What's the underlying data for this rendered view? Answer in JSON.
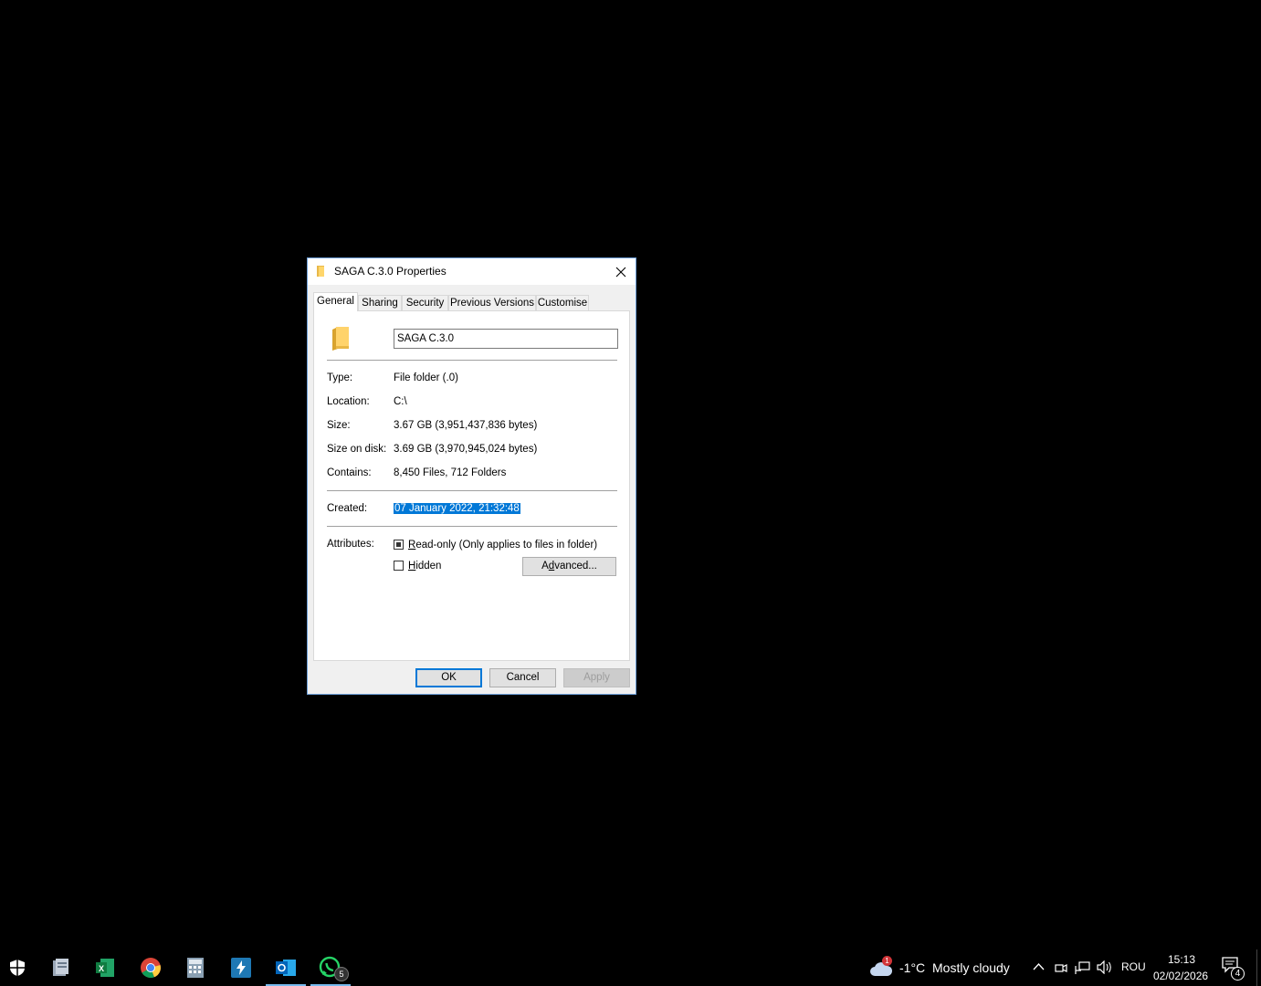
{
  "dialog": {
    "title": "SAGA C.3.0 Properties",
    "tabs": [
      {
        "label": "General",
        "active": true
      },
      {
        "label": "Sharing"
      },
      {
        "label": "Security"
      },
      {
        "label": "Previous Versions"
      },
      {
        "label": "Customise"
      }
    ],
    "folder_name": "SAGA C.3.0",
    "type_label": "Type:",
    "type_value": "File folder (.0)",
    "location_label": "Location:",
    "location_value": "C:\\",
    "size_label": "Size:",
    "size_value": "3.67 GB (3,951,437,836 bytes)",
    "size_on_disk_label": "Size on disk:",
    "size_on_disk_value": "3.69 GB (3,970,945,024 bytes)",
    "contains_label": "Contains:",
    "contains_value": "8,450 Files, 712 Folders",
    "created_label": "Created:",
    "created_value": "07 January 2022, 21:32:48",
    "attributes_label": "Attributes:",
    "readonly_hotkey": "R",
    "readonly_rest": "ead-only (Only applies to files in folder)",
    "hidden_hotkey": "H",
    "hidden_rest": "idden",
    "advanced_hotkey": "d",
    "advanced_pre": "A",
    "advanced_post": "vanced...",
    "ok_label": "OK",
    "cancel_label": "Cancel",
    "apply_label": "Apply",
    "readonly_state": "indeterminate",
    "hidden_state": "unchecked"
  },
  "taskbar": {
    "icons": [
      "security-shield-icon",
      "file-manager-icon",
      "excel-icon",
      "chrome-icon",
      "calculator-icon",
      "app-bolt-icon",
      "outlook-icon",
      "whatsapp-icon"
    ],
    "whatsapp_badge": "5",
    "weather_badge": "1",
    "temperature": "-1°C",
    "weather": "Mostly cloudy",
    "language": "ROU",
    "time": "15:13",
    "date": "02/02/2026",
    "notifications_badge": "4"
  }
}
